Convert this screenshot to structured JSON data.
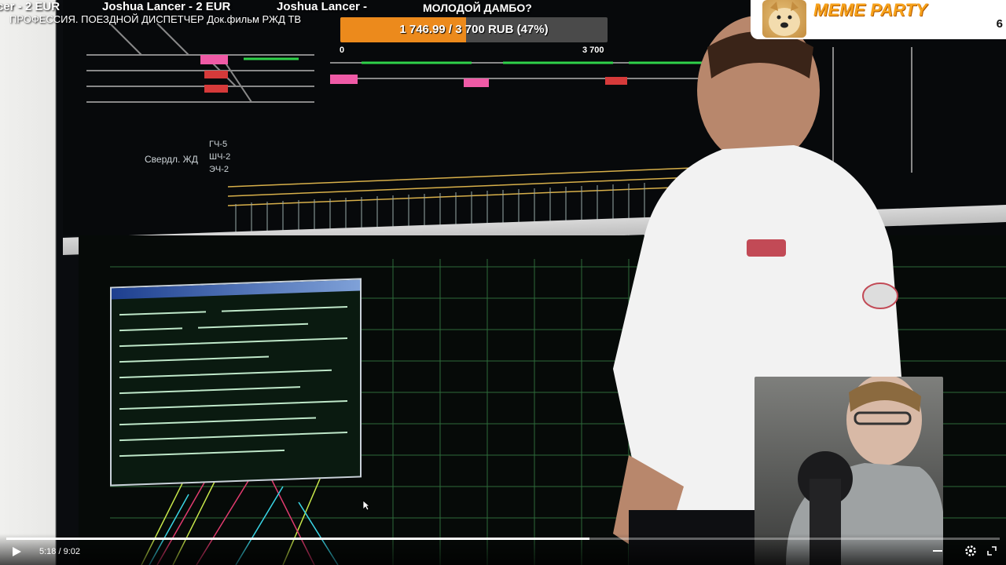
{
  "ticker": [
    {
      "text": "cer - 2 EUR"
    },
    {
      "text": "Joshua Lancer - 2 EUR"
    },
    {
      "text": "Joshua Lancer -"
    }
  ],
  "video": {
    "title": "ПРОФЕССИЯ. ПОЕЗДНОЙ ДИСПЕТЧЕР Док.фильм РЖД ТВ"
  },
  "donation_goal": {
    "title": "МОЛОДОЙ ДАМБО?",
    "progress_text": "1 746.99 / 3 700 RUB (47%)",
    "progress_fraction": 0.47,
    "min_label": "0",
    "max_label": "3 700",
    "bar_color": "#ec8a1c"
  },
  "meme_widget": {
    "title": "MEME PARTY",
    "count": "6"
  },
  "panel_labels": {
    "region": "Свердл. ЖД",
    "line1": "ГЧ-5",
    "line2": "ШЧ-2",
    "line3": "ЭЧ-2"
  },
  "player": {
    "current_time": "5:18",
    "duration": "9:02",
    "time_display": "5:18 / 9:02",
    "played_fraction": 0.587,
    "icons": [
      "play-icon",
      "pip-icon",
      "settings-icon",
      "fullscreen-icon"
    ]
  }
}
